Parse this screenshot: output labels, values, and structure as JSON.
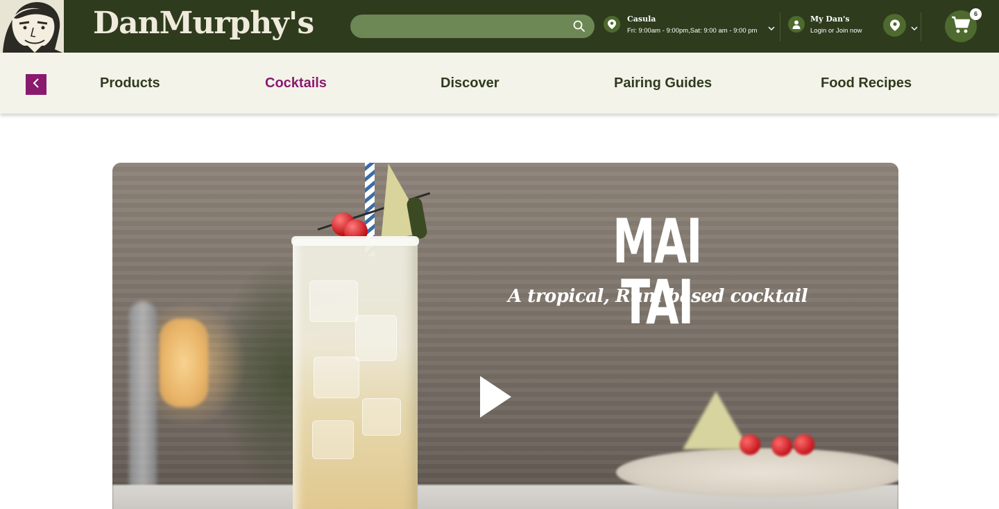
{
  "header": {
    "brand": "DanMurphy's",
    "search": {
      "placeholder": "",
      "value": ""
    },
    "store": {
      "name": "Casula",
      "hours": "Fri: 9:00am - 9:00pm,Sat: 9:00 am - 9:00 pm"
    },
    "account": {
      "title": "My Dan's",
      "subtitle": "Login or Join now"
    },
    "cart_count": "6"
  },
  "nav": {
    "items": [
      {
        "label": "Products",
        "active": false
      },
      {
        "label": "Cocktails",
        "active": true
      },
      {
        "label": "Discover",
        "active": false
      },
      {
        "label": "Pairing Guides",
        "active": false
      },
      {
        "label": "Food Recipes",
        "active": false
      }
    ]
  },
  "hero": {
    "title": "MAI TAI",
    "subtitle": "A tropical, Rum based cocktail"
  },
  "colors": {
    "header_bg": "#2e3b1d",
    "search_bg": "#6d8755",
    "nav_bg": "#f3f3ea",
    "accent": "#8a1a6e",
    "nav_text": "#2e3b1d"
  },
  "icons": {
    "search": "search-icon",
    "store_location": "location-pin-icon",
    "account": "person-icon",
    "locate": "location-pin-icon",
    "cart": "cart-icon",
    "back": "chevron-left-icon",
    "play": "play-icon"
  }
}
